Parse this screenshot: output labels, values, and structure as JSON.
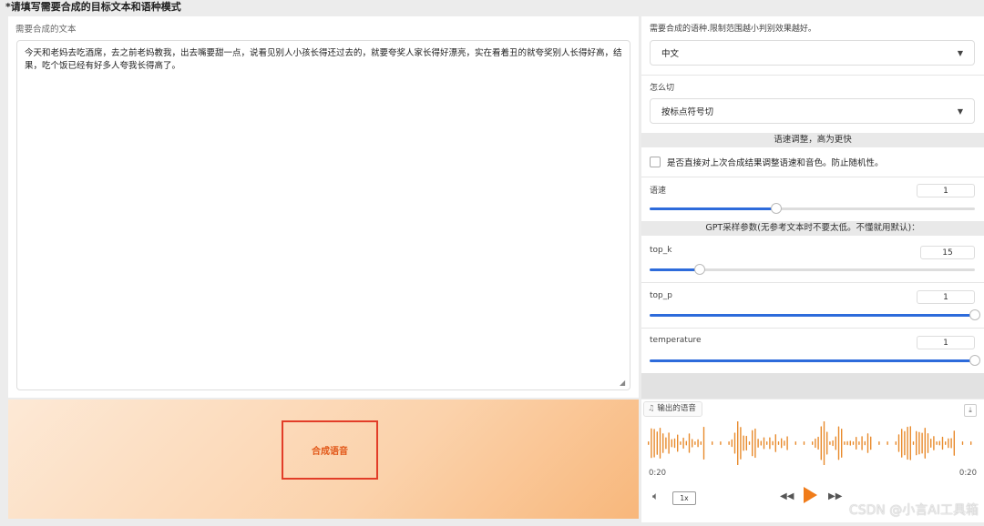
{
  "section": {
    "title": "*请填写需要合成的目标文本和语种模式"
  },
  "text_input": {
    "label": "需要合成的文本",
    "value": "今天和老妈去吃酒席，去之前老妈教我，出去嘴要甜一点，说看见别人小孩长得还过去的，就要夸奖人家长得好漂亮，实在看着丑的就夸奖别人长得好高，结果，吃个饭已经有好多人夸我长得高了。"
  },
  "synth_button": {
    "label": "合成语音"
  },
  "language": {
    "label": "需要合成的语种.限制范围越小判别效果越好。",
    "selected": "中文"
  },
  "split": {
    "label": "怎么切",
    "selected": "按标点符号切"
  },
  "speed_section": {
    "header": "语速调整，高为更快",
    "checkbox_label": "是否直接对上次合成结果调整语速和音色。防止随机性。",
    "speed_label": "语速",
    "speed_value": "1",
    "speed_fraction": 0.39
  },
  "gpt_section": {
    "header": "GPT采样参数(无参考文本时不要太低。不懂就用默认)：",
    "top_k": {
      "label": "top_k",
      "value": "15",
      "fraction": 0.155
    },
    "top_p": {
      "label": "top_p",
      "value": "1",
      "fraction": 1.0
    },
    "temperature": {
      "label": "temperature",
      "value": "1",
      "fraction": 1.0
    }
  },
  "audio": {
    "label": "输出的语音",
    "current_time": "0:20",
    "duration": "0:20",
    "rate": "1x"
  },
  "watermark": "CSDN @小言AI工具箱",
  "colors": {
    "accent": "#2d6bdb",
    "wave": "#e88a2c",
    "play": "#f07c1a",
    "highlight_box": "#e23d28"
  }
}
